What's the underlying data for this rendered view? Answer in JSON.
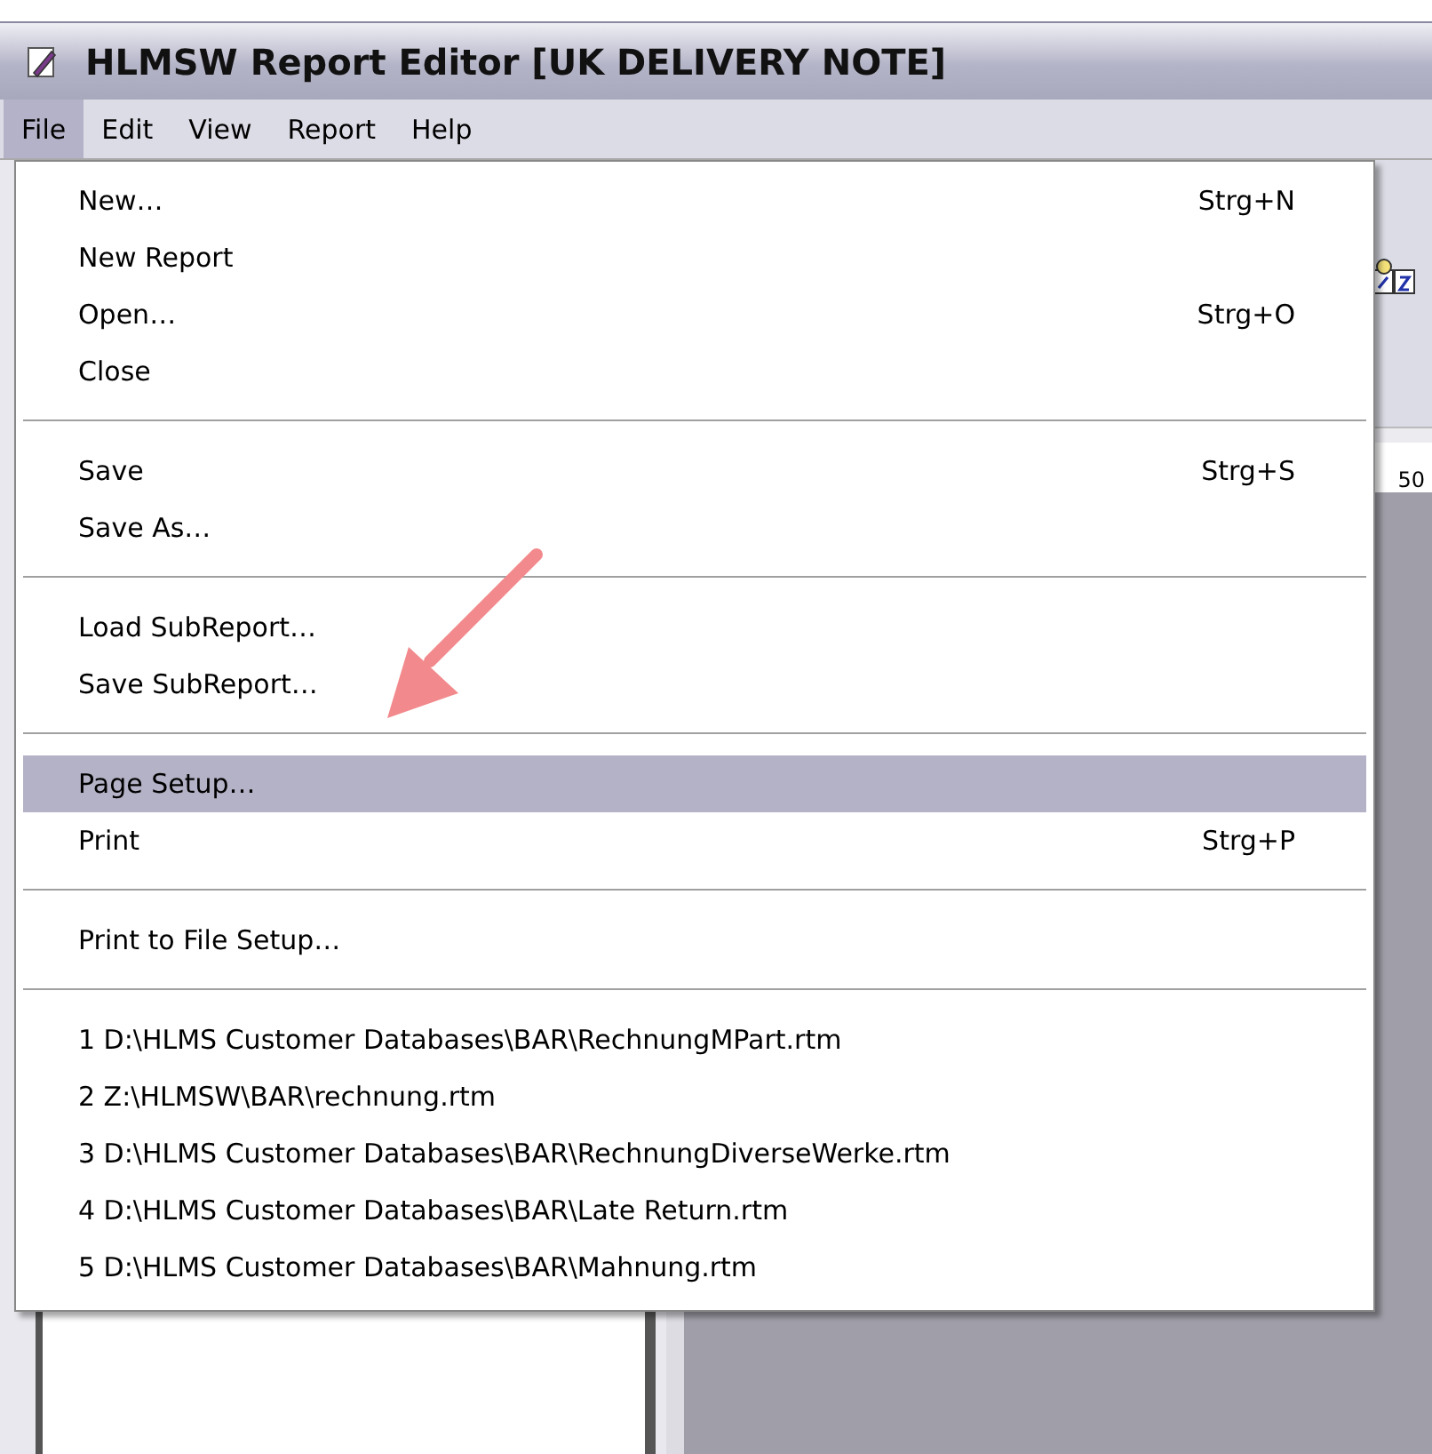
{
  "window": {
    "title": "HLMSW Report Editor [UK DELIVERY NOTE]"
  },
  "menubar": [
    {
      "label": "File",
      "selected": true
    },
    {
      "label": "Edit",
      "selected": false
    },
    {
      "label": "View",
      "selected": false
    },
    {
      "label": "Report",
      "selected": false
    },
    {
      "label": "Help",
      "selected": false
    }
  ],
  "file_menu": [
    {
      "kind": "item",
      "label": "New…",
      "shortcut": "Strg+N",
      "selected": false
    },
    {
      "kind": "item",
      "label": "New Report",
      "selected": false
    },
    {
      "kind": "item",
      "label": "Open…",
      "shortcut": "Strg+O",
      "selected": false
    },
    {
      "kind": "item",
      "label": "Close",
      "selected": false
    },
    {
      "kind": "separator"
    },
    {
      "kind": "item",
      "label": "Save",
      "shortcut": "Strg+S",
      "selected": false
    },
    {
      "kind": "item",
      "label": "Save As…",
      "selected": false
    },
    {
      "kind": "separator"
    },
    {
      "kind": "item",
      "label": "Load SubReport…",
      "selected": false
    },
    {
      "kind": "item",
      "label": "Save SubReport…",
      "selected": false
    },
    {
      "kind": "separator"
    },
    {
      "kind": "item",
      "label": "Page Setup…",
      "selected": true
    },
    {
      "kind": "item",
      "label": "Print",
      "shortcut": "Strg+P",
      "selected": false
    },
    {
      "kind": "separator"
    },
    {
      "kind": "item",
      "label": "Print to File Setup…",
      "selected": false
    },
    {
      "kind": "separator"
    },
    {
      "kind": "item",
      "label": "1 D:\\HLMS Customer Databases\\BAR\\RechnungMPart.rtm",
      "selected": false
    },
    {
      "kind": "item",
      "label": "2 Z:\\HLMSW\\BAR\\rechnung.rtm",
      "selected": false
    },
    {
      "kind": "item",
      "label": "3 D:\\HLMS Customer Databases\\BAR\\RechnungDiverseWerke.rtm",
      "selected": false
    },
    {
      "kind": "item",
      "label": "4 D:\\HLMS Customer Databases\\BAR\\Late Return.rtm",
      "selected": false
    },
    {
      "kind": "item",
      "label": "5 D:\\HLMS Customer Databases\\BAR\\Mahnung.rtm",
      "selected": false
    }
  ],
  "ruler": {
    "label": "50"
  }
}
